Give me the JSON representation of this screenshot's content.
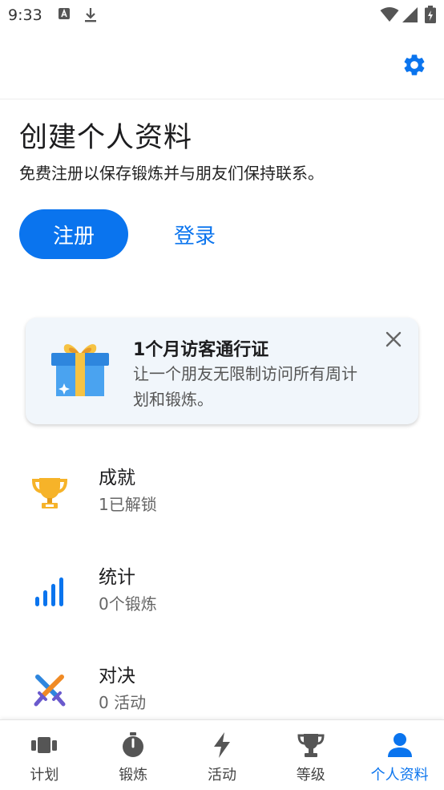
{
  "status_bar": {
    "time": "9:33"
  },
  "header": {
    "settings_icon": "gear-icon"
  },
  "profile": {
    "title": "创建个人资料",
    "subtitle": "免费注册以保存锻炼并与朋友们保持联系。",
    "register_label": "注册",
    "login_label": "登录"
  },
  "promo": {
    "title": "1个月访客通行证",
    "description": "让一个朋友无限制访问所有周计划和锻炼。",
    "icon": "gift-icon"
  },
  "stats": [
    {
      "title": "成就",
      "subtitle": "1已解锁",
      "icon": "trophy-icon"
    },
    {
      "title": "统计",
      "subtitle": "0个锻炼",
      "icon": "bar-chart-icon"
    },
    {
      "title": "对决",
      "subtitle": "0 活动",
      "icon": "crossed-swords-icon"
    }
  ],
  "nav": {
    "items": [
      {
        "label": "计划",
        "icon": "plan-icon"
      },
      {
        "label": "锻炼",
        "icon": "stopwatch-icon"
      },
      {
        "label": "活动",
        "icon": "lightning-icon"
      },
      {
        "label": "等级",
        "icon": "trophy-icon"
      },
      {
        "label": "个人资料",
        "icon": "person-icon"
      }
    ],
    "active_index": 4
  },
  "colors": {
    "accent": "#0a74ee",
    "card_bg": "#f1f6fb"
  }
}
